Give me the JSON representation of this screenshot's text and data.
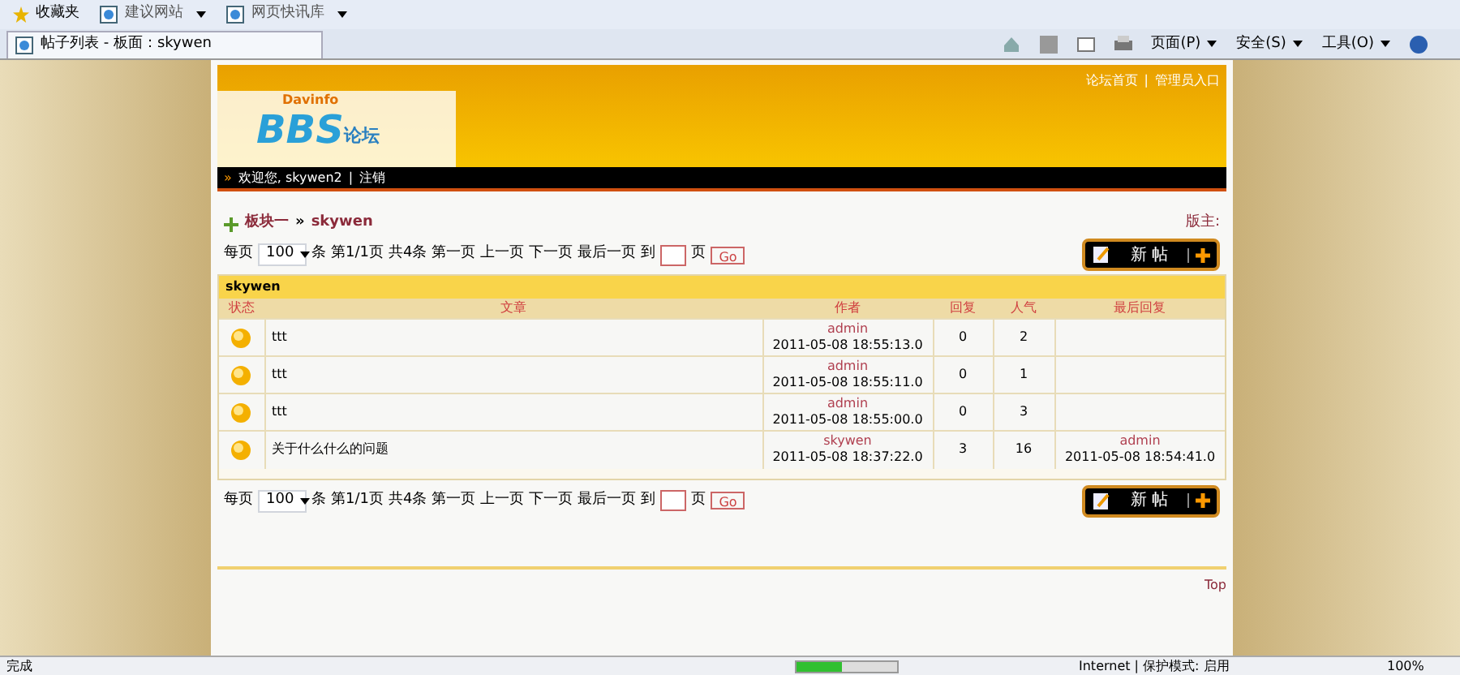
{
  "browser": {
    "favorites": "收藏夹",
    "links": [
      {
        "label": "建议网站"
      },
      {
        "label": "网页快讯库"
      }
    ],
    "tab_title": "帖子列表 - 板面：skywen",
    "menus": [
      {
        "label": "页面(P)"
      },
      {
        "label": "安全(S)"
      },
      {
        "label": "工具(O)"
      }
    ]
  },
  "header": {
    "logo_small": "Davinfo",
    "logo_big": "BBS",
    "logo_cn": "论坛",
    "top_links": [
      "论坛首页",
      "管理员入口"
    ],
    "separator": "|",
    "welcome_mark": "»",
    "welcome": "欢迎您, skywen2",
    "logout": "注销"
  },
  "breadcrumb": {
    "items": [
      "板块一",
      "skywen"
    ],
    "separator": "»",
    "moderator": "版主:"
  },
  "pagers": [
    {
      "per_page_label": "每页",
      "per_page": "100",
      "unit": "条",
      "page_info": "第1/1页",
      "total": "共4条",
      "links": [
        "第一页",
        "上一页",
        "下一页",
        "最后一页"
      ],
      "goto": "到",
      "page": "页",
      "go": "Go",
      "new_post": "新 帖"
    },
    {
      "per_page_label": "每页",
      "per_page": "100",
      "unit": "条",
      "page_info": "第1/1页",
      "total": "共4条",
      "links": [
        "第一页",
        "上一页",
        "下一页",
        "最后一页"
      ],
      "goto": "到",
      "page": "页",
      "go": "Go",
      "new_post": "新 帖"
    }
  ],
  "table": {
    "title": "skywen",
    "columns": [
      "状态",
      "文章",
      "作者",
      "回复",
      "人气",
      "最后回复"
    ],
    "rows": [
      {
        "title": "ttt",
        "author": "admin",
        "time": "2011-05-08 18:55:13.0",
        "replies": "0",
        "views": "2"
      },
      {
        "title": "ttt",
        "author": "admin",
        "time": "2011-05-08 18:55:11.0",
        "replies": "0",
        "views": "1"
      },
      {
        "title": "ttt",
        "author": "admin",
        "time": "2011-05-08 18:55:00.0",
        "replies": "0",
        "views": "3"
      },
      {
        "title": "关于什么什么的问题",
        "author": "skywen",
        "time": "2011-05-08 18:37:22.0",
        "replies": "3",
        "views": "16",
        "last_author": "admin",
        "last_time": "2011-05-08 18:54:41.0"
      }
    ]
  },
  "footer": {
    "top": "Top"
  },
  "status_bar": {
    "text": "完成",
    "progress": {
      "level": 0.45
    },
    "zone": "Internet | 保护模式: 启用",
    "zoom": "100%"
  }
}
